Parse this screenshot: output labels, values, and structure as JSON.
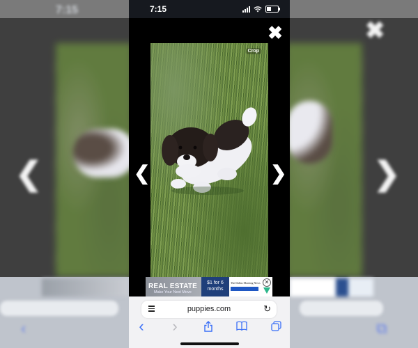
{
  "status_bar": {
    "time": "7:15",
    "battery_level": 0.4
  },
  "viewer": {
    "close_glyph": "✖",
    "crop_label": "Crop",
    "prev_glyph": "❮",
    "next_glyph": "❯"
  },
  "ad": {
    "headline": "REAL ESTATE",
    "tagline": "Make Your Next Move",
    "offer": "$1 for 6 months",
    "brand": "The Dallas Morning News",
    "close_glyph": "✕"
  },
  "browser": {
    "domain": "puppies.com",
    "reload_glyph": "↻",
    "toolbar_icons": [
      "back-icon",
      "forward-icon",
      "share-icon",
      "bookmarks-icon",
      "tabs-icon"
    ],
    "back_glyph": "‹",
    "forward_glyph": "›",
    "share_glyph": "⇧",
    "bookmarks_glyph": "📖",
    "tabs_glyph": "⧉"
  },
  "colors": {
    "accent": "#3a6ff7",
    "ad_navy": "#1f3f7a",
    "ad_blue": "#1f57c3"
  }
}
